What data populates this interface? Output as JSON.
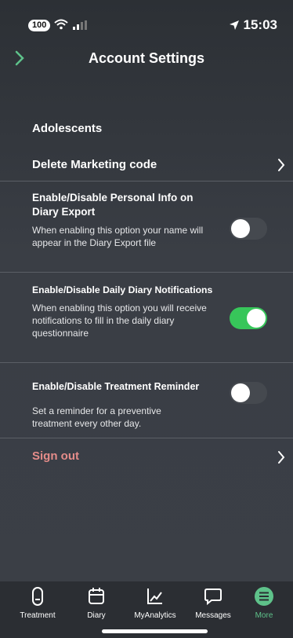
{
  "status": {
    "battery": "100",
    "time": "15:03"
  },
  "header": {
    "title": "Account Settings"
  },
  "section": {
    "label": "Adolescents"
  },
  "delete_row": {
    "label": "Delete  Marketing code"
  },
  "settings": [
    {
      "title": "Enable/Disable Personal Info on Diary Export",
      "description": "When enabling this option your name will appear in the Diary Export file",
      "enabled": false
    },
    {
      "title": "Enable/Disable Daily Diary Notifications",
      "description": "When enabling this option you will receive notifications to fill in the daily diary questionnaire",
      "enabled": true
    },
    {
      "title": "Enable/Disable Treatment Reminder",
      "description": "Set a reminder for a preventive treatment every other day.",
      "enabled": false
    }
  ],
  "signout": {
    "label": "Sign out"
  },
  "tabs": [
    {
      "label": "Treatment",
      "icon": "pill-icon"
    },
    {
      "label": "Diary",
      "icon": "calendar-icon"
    },
    {
      "label": "MyAnalytics",
      "icon": "chart-icon"
    },
    {
      "label": "Messages",
      "icon": "message-icon"
    },
    {
      "label": "More",
      "icon": "menu-icon",
      "active": true
    }
  ],
  "colors": {
    "accent": "#5ec28a",
    "toggle_on": "#37c65a",
    "signout": "#e58c8a"
  }
}
